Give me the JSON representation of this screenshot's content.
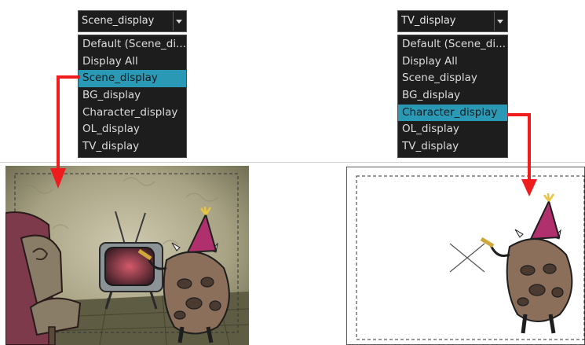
{
  "left_dropdown": {
    "selected_value": "Scene_display",
    "options": [
      "Default (Scene_di...",
      "Display All",
      "Scene_display",
      "BG_display",
      "Character_display",
      "OL_display",
      "TV_display"
    ],
    "highlighted_index": 2
  },
  "right_dropdown": {
    "selected_value": "TV_display",
    "options": [
      "Default (Scene_di...",
      "Display All",
      "Scene_display",
      "BG_display",
      "Character_display",
      "OL_display",
      "TV_display"
    ],
    "highlighted_index": 4
  },
  "colors": {
    "menu_background": "#1d1d1d",
    "menu_text": "#dcdcdc",
    "highlight": "#2a99b5",
    "arrow": "#ee1c1c"
  },
  "icons": [
    "chevron-down-icon",
    "red-arrow-icon",
    "character-icon",
    "party-hat-icon",
    "tv-icon",
    "armchair-icon",
    "x-mark-icon"
  ]
}
